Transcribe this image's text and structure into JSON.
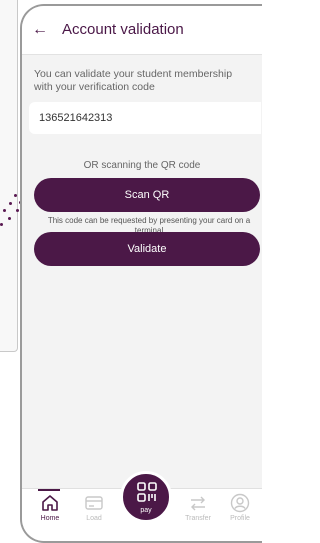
{
  "header": {
    "back_icon": "arrow-left-icon",
    "title": "Account validation"
  },
  "intro_text": "You can validate your student membership with your verification code",
  "code_field": {
    "value": "136521642313",
    "placeholder": ""
  },
  "or_text": "OR scanning the QR code",
  "scan_button": "Scan QR",
  "hint_text": "This code can be requested by presenting your card on a terminal",
  "validate_button": "Validate",
  "nav": {
    "items": [
      {
        "label": "Home",
        "icon": "home-icon",
        "active": true
      },
      {
        "label": "Load",
        "icon": "card-icon",
        "active": false
      },
      {
        "label": "pay",
        "icon": "qr-code-icon",
        "active": false
      },
      {
        "label": "Transfer",
        "icon": "transfer-icon",
        "active": false
      },
      {
        "label": "Profile",
        "icon": "profile-icon",
        "active": false
      }
    ]
  },
  "colors": {
    "brand": "#4b1847",
    "background": "#f3f3f3"
  }
}
